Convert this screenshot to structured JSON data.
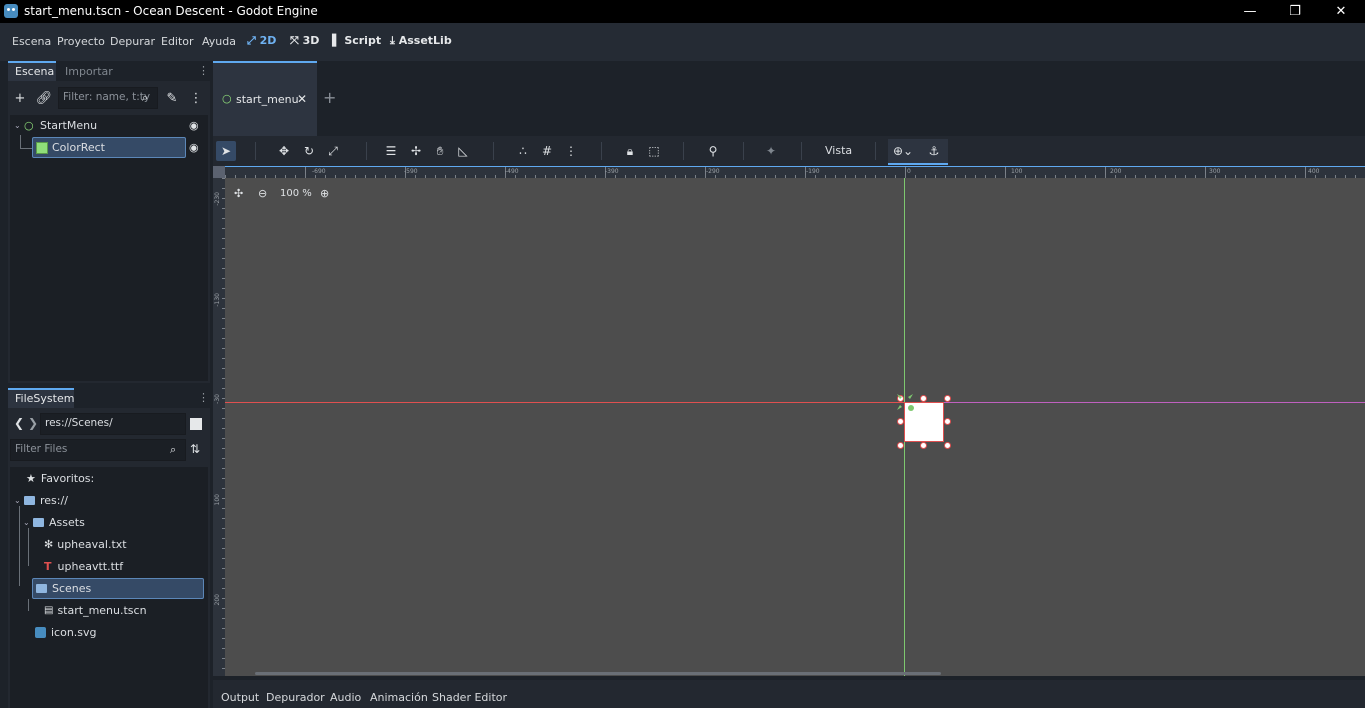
{
  "window": {
    "title": "start_menu.tscn - Ocean Descent - Godot Engine",
    "minimize": "—",
    "maximize": "❐",
    "close": "✕"
  },
  "menu": {
    "items": [
      "Escena",
      "Proyecto",
      "Depurar",
      "Editor",
      "Ayuda"
    ]
  },
  "workspaces": {
    "items": [
      {
        "label": "2D",
        "icon": "2d-icon"
      },
      {
        "label": "3D",
        "icon": "3d-icon"
      },
      {
        "label": "Script",
        "icon": "script-icon"
      },
      {
        "label": "AssetLib",
        "icon": "assetlib-icon"
      }
    ],
    "active": "2D"
  },
  "scene_dock": {
    "tabs": [
      "Escena",
      "Importar"
    ],
    "filter_placeholder": "Filter: name, t:ty",
    "nodes": [
      {
        "label": "StartMenu",
        "icon": "control-node-icon",
        "visible": true
      },
      {
        "label": "ColorRect",
        "icon": "colorrect-node-icon",
        "visible": true,
        "selected": true
      }
    ]
  },
  "filesystem": {
    "tab": "FileSystem",
    "path": "res://Scenes/",
    "filter_placeholder": "Filter Files",
    "favorites": "Favoritos:",
    "tree": [
      {
        "label": "res://",
        "icon": "folder-icon"
      },
      {
        "label": "Assets",
        "icon": "folder-icon"
      },
      {
        "label": "upheaval.txt",
        "icon": "text-file-icon"
      },
      {
        "label": "upheavtt.ttf",
        "icon": "font-file-icon"
      },
      {
        "label": "Scenes",
        "icon": "folder-icon",
        "selected": true
      },
      {
        "label": "start_menu.tscn",
        "icon": "scene-file-icon"
      },
      {
        "label": "icon.svg",
        "icon": "svg-file-icon"
      }
    ]
  },
  "editor": {
    "tabs": [
      {
        "label": "start_menu",
        "close": "✕"
      }
    ],
    "new_tab": "+",
    "toolbar": {
      "view_menu": "Vista"
    },
    "zoom": "100 %",
    "ruler_top": [
      "-690",
      "-590",
      "-490",
      "-390",
      "-290",
      "-190",
      "0",
      "100",
      "200",
      "300",
      "400"
    ],
    "ruler_left": [
      "-230",
      "-130",
      "-30",
      "100",
      "200"
    ]
  },
  "bottom_panel": {
    "tabs": [
      "Output",
      "Depurador",
      "Audio",
      "Animación",
      "Shader Editor"
    ]
  },
  "colors": {
    "accent": "#5fa9f0",
    "viewport": "#4d4d4d",
    "x_axis": "#e05050",
    "y_axis": "#7ec86f",
    "selection": "#354a66"
  }
}
